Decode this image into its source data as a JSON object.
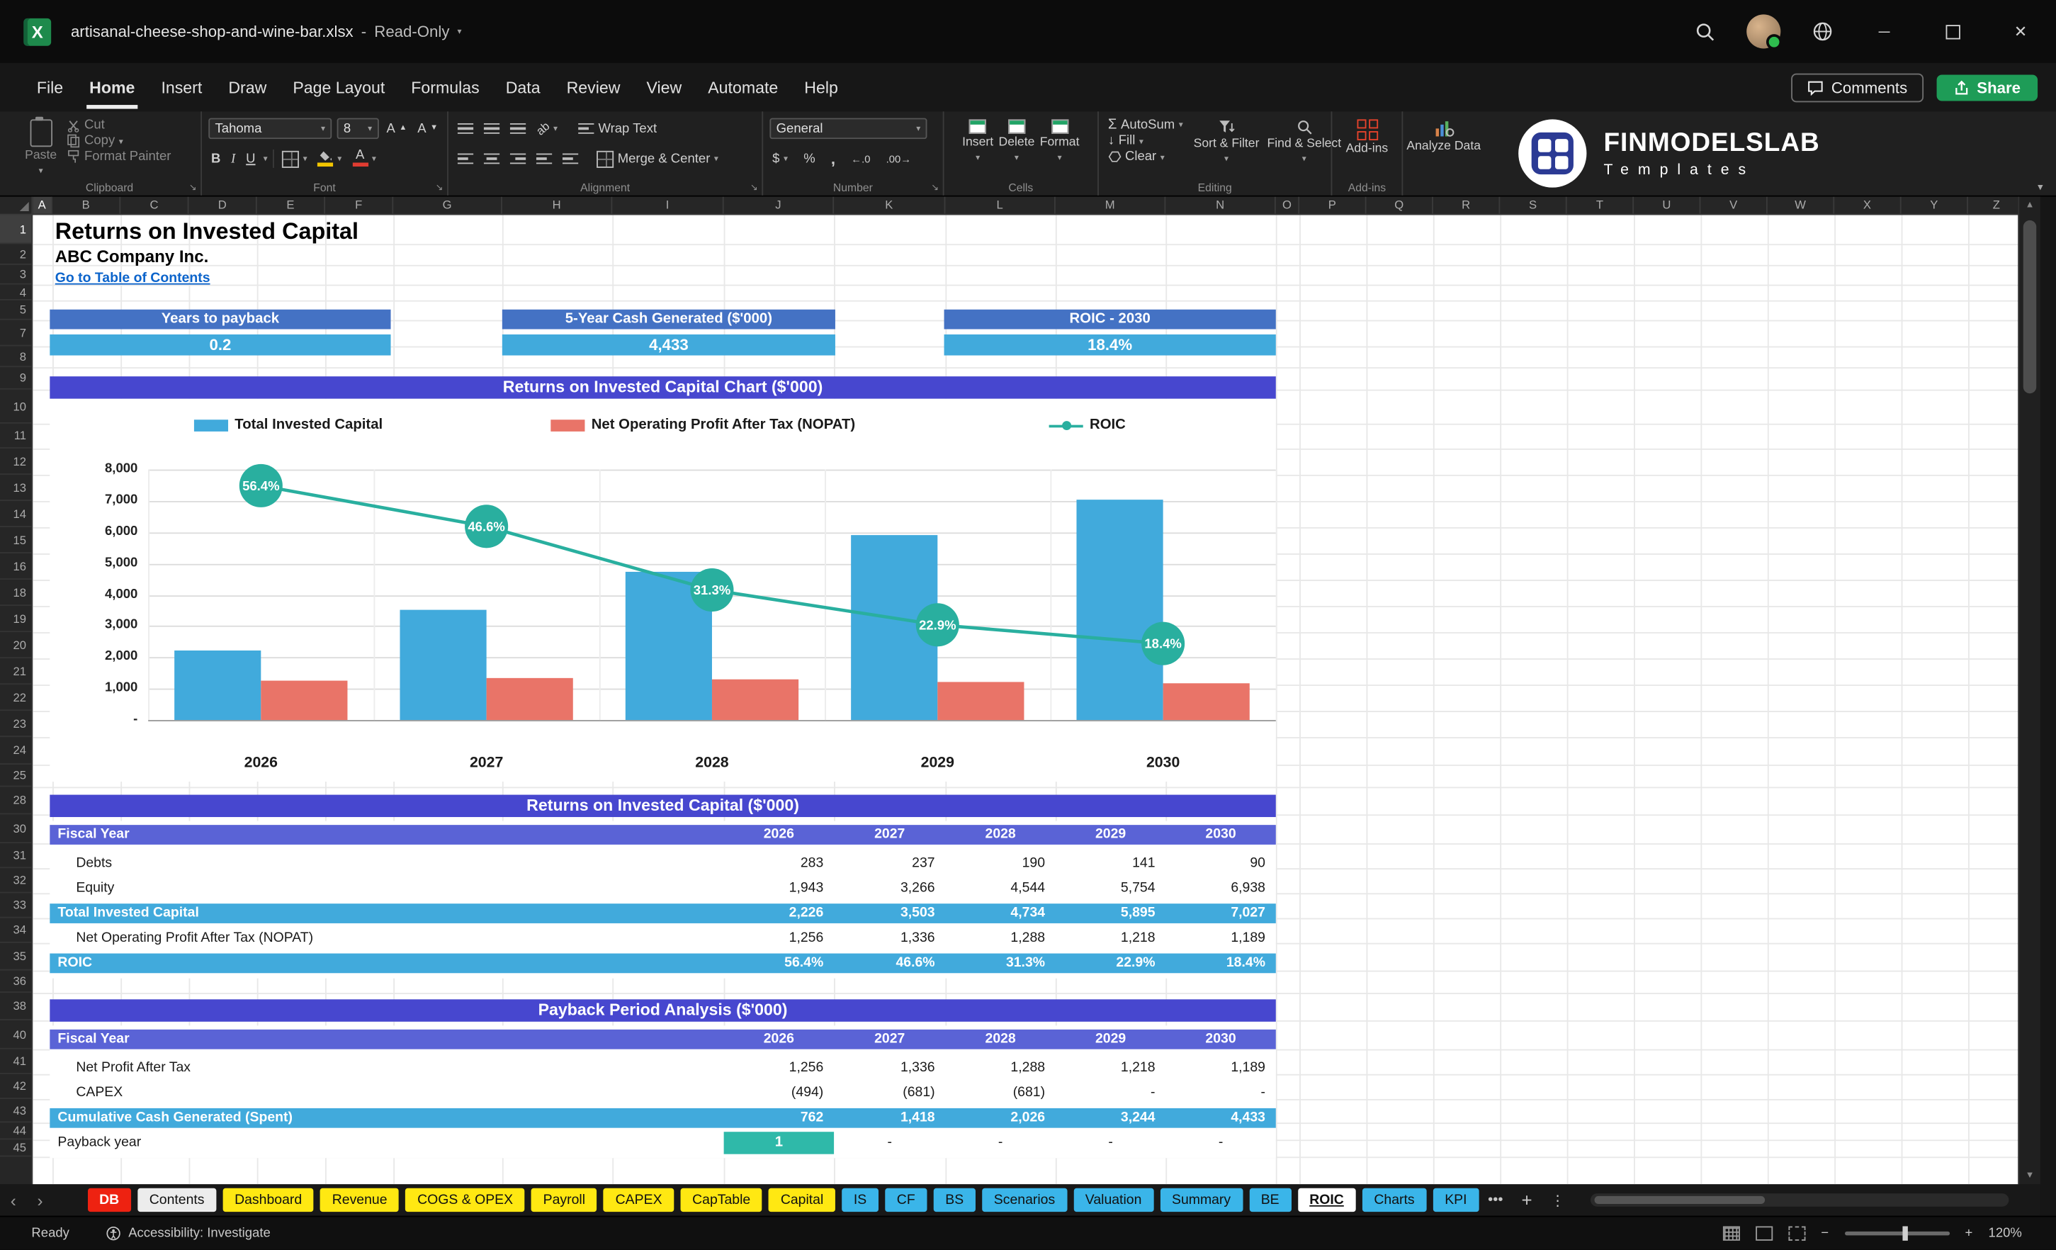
{
  "titlebar": {
    "filename": "artisanal-cheese-shop-and-wine-bar.xlsx",
    "separator": "-",
    "mode": "Read-Only"
  },
  "menu": {
    "items": [
      "File",
      "Home",
      "Insert",
      "Draw",
      "Page Layout",
      "Formulas",
      "Data",
      "Review",
      "View",
      "Automate",
      "Help"
    ],
    "active_index": 1,
    "comments": "Comments",
    "share": "Share"
  },
  "ribbon": {
    "clipboard": {
      "group": "Clipboard",
      "paste": "Paste",
      "cut": "Cut",
      "copy": "Copy",
      "format_painter": "Format Painter"
    },
    "font": {
      "group": "Font",
      "family": "Tahoma",
      "size": "8",
      "bold": "B",
      "italic": "I",
      "underline": "U",
      "font_color_letter": "A"
    },
    "alignment": {
      "group": "Alignment",
      "wrap_text": "Wrap Text",
      "merge_center": "Merge & Center",
      "orientation": "ab"
    },
    "number": {
      "group": "Number",
      "format": "General",
      "currency": "$",
      "percent": "%",
      "comma": ",",
      "inc_decimal": "←.0",
      "dec_decimal": ".00→"
    },
    "cells": {
      "group": "Cells",
      "insert": "Insert",
      "delete": "Delete",
      "format": "Format"
    },
    "editing": {
      "group": "Editing",
      "autosum": "AutoSum",
      "sigma": "Σ",
      "fill": "Fill",
      "clear": "Clear",
      "sort_filter": "Sort & Filter",
      "find_select": "Find & Select"
    },
    "addins": {
      "group": "Add-ins",
      "addins": "Add-ins",
      "analyze_data": "Analyze Data"
    }
  },
  "brand": {
    "name": "FINMODELSLAB",
    "tagline": "Templates"
  },
  "grid": {
    "columns": [
      "A",
      "B",
      "C",
      "D",
      "E",
      "F",
      "G",
      "H",
      "I",
      "J",
      "K",
      "L",
      "M",
      "N",
      "O",
      "P",
      "Q",
      "R",
      "S",
      "T",
      "U",
      "V",
      "W",
      "X",
      "Y",
      "Z"
    ],
    "rows": [
      "1",
      "2",
      "3",
      "4",
      "5",
      "7",
      "8",
      "9",
      "10",
      "11",
      "12",
      "13",
      "14",
      "15",
      "16",
      "18",
      "19",
      "20",
      "21",
      "22",
      "23",
      "24",
      "25",
      "28",
      "30",
      "31",
      "32",
      "33",
      "34",
      "35",
      "36",
      "38",
      "40",
      "41",
      "42",
      "43",
      "44",
      "45"
    ]
  },
  "sheet": {
    "title": "Returns on Invested Capital",
    "company": "ABC Company Inc.",
    "link": "Go to Table of Contents",
    "kpis": [
      {
        "label": "Years to payback",
        "value": "0.2"
      },
      {
        "label": "5-Year Cash Generated ($'000)",
        "value": "4,433"
      },
      {
        "label": "ROIC - 2030",
        "value": "18.4%"
      }
    ],
    "table1": {
      "title": "Returns on Invested Capital ($'000)",
      "header": [
        "Fiscal Year",
        "2026",
        "2027",
        "2028",
        "2029",
        "2030"
      ],
      "rows": [
        {
          "label": "Debts",
          "values": [
            "283",
            "237",
            "190",
            "141",
            "90"
          ],
          "style": "normal"
        },
        {
          "label": "Equity",
          "values": [
            "1,943",
            "3,266",
            "4,544",
            "5,754",
            "6,938"
          ],
          "style": "normal"
        },
        {
          "label": "Total Invested Capital",
          "values": [
            "2,226",
            "3,503",
            "4,734",
            "5,895",
            "7,027"
          ],
          "style": "highlight"
        },
        {
          "label": "Net Operating Profit After Tax (NOPAT)",
          "values": [
            "1,256",
            "1,336",
            "1,288",
            "1,218",
            "1,189"
          ],
          "style": "normal"
        },
        {
          "label": "ROIC",
          "values": [
            "56.4%",
            "46.6%",
            "31.3%",
            "22.9%",
            "18.4%"
          ],
          "style": "highlight"
        }
      ]
    },
    "table2": {
      "title": "Payback Period Analysis ($'000)",
      "header": [
        "Fiscal Year",
        "2026",
        "2027",
        "2028",
        "2029",
        "2030"
      ],
      "rows": [
        {
          "label": "Net Profit After Tax",
          "values": [
            "1,256",
            "1,336",
            "1,288",
            "1,218",
            "1,189"
          ],
          "style": "normal"
        },
        {
          "label": "CAPEX",
          "values": [
            "(494)",
            "(681)",
            "(681)",
            "-",
            "-"
          ],
          "style": "normal"
        },
        {
          "label": "Cumulative Cash Generated (Spent)",
          "values": [
            "762",
            "1,418",
            "2,026",
            "3,244",
            "4,433"
          ],
          "style": "highlight"
        },
        {
          "label": "Payback year",
          "values": [
            "1",
            "-",
            "-",
            "-",
            "-"
          ],
          "style": "payback"
        }
      ]
    }
  },
  "chart_data": {
    "type": "combo",
    "title": "Returns on Invested Capital Chart ($'000)",
    "categories": [
      "2026",
      "2027",
      "2028",
      "2029",
      "2030"
    ],
    "series": [
      {
        "name": "Total Invested Capital",
        "type": "bar",
        "color": "#41AADC",
        "values": [
          2226,
          3503,
          4734,
          5895,
          7027
        ]
      },
      {
        "name": "Net Operating Profit After Tax (NOPAT)",
        "type": "bar",
        "color": "#E97468",
        "values": [
          1256,
          1336,
          1288,
          1218,
          1189
        ]
      },
      {
        "name": "ROIC",
        "type": "line",
        "color": "#29AF9F",
        "values_percent": [
          56.4,
          46.6,
          31.3,
          22.9,
          18.4
        ],
        "labels": [
          "56.4%",
          "46.6%",
          "31.3%",
          "22.9%",
          "18.4%"
        ]
      }
    ],
    "y_axis": {
      "ticks": [
        "8,000",
        "7,000",
        "6,000",
        "5,000",
        "4,000",
        "3,000",
        "2,000",
        "1,000",
        "-"
      ],
      "min": 0,
      "max": 8000
    },
    "legend_position": "top",
    "gridlines": true
  },
  "sheet_tabs": {
    "nav_left": "‹",
    "nav_right": "›",
    "tabs": [
      {
        "label": "DB",
        "type": "red"
      },
      {
        "label": "Contents",
        "type": "light"
      },
      {
        "label": "Dashboard",
        "type": "yellow"
      },
      {
        "label": "Revenue",
        "type": "yellow"
      },
      {
        "label": "COGS & OPEX",
        "type": "yellow"
      },
      {
        "label": "Payroll",
        "type": "yellow"
      },
      {
        "label": "CAPEX",
        "type": "yellow"
      },
      {
        "label": "CapTable",
        "type": "yellow"
      },
      {
        "label": "Capital",
        "type": "yellow"
      },
      {
        "label": "IS",
        "type": "blue"
      },
      {
        "label": "CF",
        "type": "blue"
      },
      {
        "label": "BS",
        "type": "blue"
      },
      {
        "label": "Scenarios",
        "type": "blue"
      },
      {
        "label": "Valuation",
        "type": "blue"
      },
      {
        "label": "Summary",
        "type": "blue"
      },
      {
        "label": "BE",
        "type": "blue"
      },
      {
        "label": "ROIC",
        "type": "active"
      },
      {
        "label": "Charts",
        "type": "blue"
      },
      {
        "label": "KPI",
        "type": "blue"
      }
    ],
    "more": "•••",
    "add": "+",
    "menu": "⋮"
  },
  "statusbar": {
    "ready": "Ready",
    "accessibility": "Accessibility: Investigate",
    "zoom": "120%",
    "zoom_out": "−",
    "zoom_in": "+"
  },
  "colors": {
    "kpi_header": "#4472C4",
    "kpi_value": "#41AADC",
    "section_header": "#4747CF",
    "table_header": "#5A63D6",
    "highlight_row": "#41AADC",
    "payback_cell": "#2FB9A9",
    "bar_blue": "#41AADC",
    "bar_red": "#E97468",
    "line_teal": "#29AF9F",
    "link": "#0C64CB",
    "tab_yellow": "#FFE812",
    "tab_blue": "#3AB5E9",
    "tab_red": "#EE2211",
    "share_green": "#1E9C57"
  }
}
